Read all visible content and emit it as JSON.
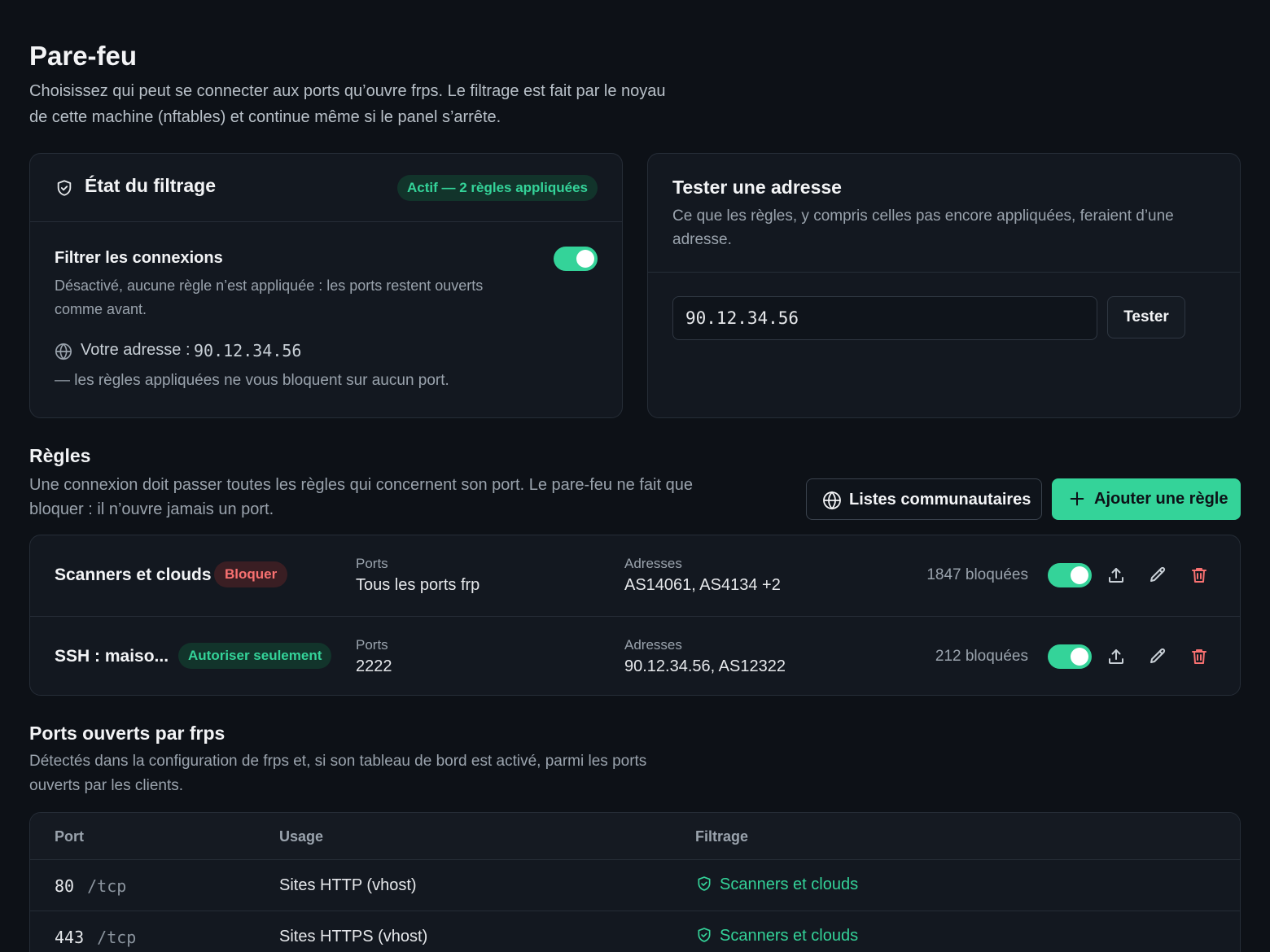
{
  "header": {
    "title": "Pare-feu",
    "description": "Choisissez qui peut se connecter aux ports qu’ouvre frps. Le filtrage est fait par le noyau de cette machine (nftables) et continue même si le panel s’arrête."
  },
  "status": {
    "title": "État du filtrage",
    "badge": "Actif — 2 règles appliquées",
    "filter_title": "Filtrer les connexions",
    "filter_desc": "Désactivé, aucune règle n’est appliquée : les ports restent ouverts comme avant.",
    "filter_enabled": true,
    "address_label": "Votre adresse :",
    "address_value": "90.12.34.56",
    "address_note": "— les règles appliquées ne vous bloquent sur aucun port."
  },
  "test": {
    "title": "Tester une adresse",
    "description": "Ce que les règles, y compris celles pas encore appliquées, feraient d’une adresse.",
    "input_value": "90.12.34.56",
    "button_label": "Tester"
  },
  "rules": {
    "title": "Règles",
    "description": "Une connexion doit passer toutes les règles qui concernent son port. Le pare-feu ne fait que bloquer : il n’ouvre jamais un port.",
    "community_button": "Listes communautaires",
    "add_button": "Ajouter une règle",
    "ports_label": "Ports",
    "addresses_label": "Adresses",
    "items": [
      {
        "name": "Scanners et clouds",
        "action": "Bloquer",
        "ports": "Tous les ports frp",
        "addresses": "AS14061, AS4134 +2",
        "blocked": "1847 bloquées",
        "enabled": true
      },
      {
        "name": "SSH : maiso...",
        "action": "Autoriser seulement",
        "ports": "2222",
        "addresses": "90.12.34.56, AS12322",
        "blocked": "212 bloquées",
        "enabled": true
      }
    ]
  },
  "ports": {
    "title": "Ports ouverts par frps",
    "description": "Détectés dans la configuration de frps et, si son tableau de bord est activé, parmi les ports ouverts par les clients.",
    "columns": [
      "Port",
      "Usage",
      "Filtrage"
    ],
    "rows": [
      {
        "port": "80",
        "proto": "/tcp",
        "usage": "Sites HTTP (vhost)",
        "filter": "Scanners et clouds"
      },
      {
        "port": "443",
        "proto": "/tcp",
        "usage": "Sites HTTPS (vhost)",
        "filter": "Scanners et clouds"
      }
    ]
  },
  "colors": {
    "accent": "#34d399",
    "danger": "#f87171",
    "background": "#0d1117",
    "card": "#131820"
  },
  "icons": [
    "shield-check-icon",
    "globe-icon",
    "plus-icon",
    "upload-icon",
    "pencil-icon",
    "trash-icon"
  ]
}
